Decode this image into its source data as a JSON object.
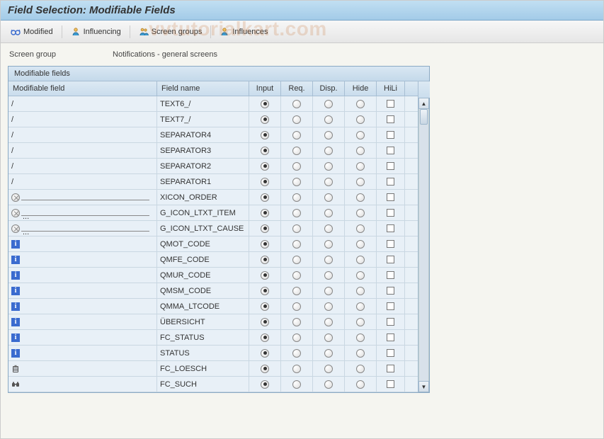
{
  "title": "Field Selection: Modifiable Fields",
  "toolbar": {
    "modified_label": "Modified",
    "influencing_label": "Influencing",
    "screen_groups_label": "Screen groups",
    "influences_label": "Influences"
  },
  "screen_group": {
    "label": "Screen group",
    "value": "Notifications - general screens"
  },
  "table": {
    "title": "Modifiable fields",
    "columns": {
      "modifiable_field": "Modifiable field",
      "field_name": "Field name",
      "input": "Input",
      "req": "Req.",
      "disp": "Disp.",
      "hide": "Hide",
      "hili": "HiLi"
    },
    "rows": [
      {
        "icon": "none",
        "modfield": "/",
        "line": false,
        "dots": false,
        "field_name": "TEXT6_/",
        "sel": "input"
      },
      {
        "icon": "none",
        "modfield": "/",
        "line": false,
        "dots": false,
        "field_name": "TEXT7_/",
        "sel": "input"
      },
      {
        "icon": "none",
        "modfield": "/",
        "line": false,
        "dots": false,
        "field_name": "SEPARATOR4",
        "sel": "input"
      },
      {
        "icon": "none",
        "modfield": "/",
        "line": false,
        "dots": false,
        "field_name": "SEPARATOR3",
        "sel": "input"
      },
      {
        "icon": "none",
        "modfield": "/",
        "line": false,
        "dots": false,
        "field_name": "SEPARATOR2",
        "sel": "input"
      },
      {
        "icon": "none",
        "modfield": "/",
        "line": false,
        "dots": false,
        "field_name": "SEPARATOR1",
        "sel": "input"
      },
      {
        "icon": "blank-o",
        "modfield": "",
        "line": true,
        "dots": false,
        "field_name": "XICON_ORDER",
        "sel": "input"
      },
      {
        "icon": "blank-o",
        "modfield": "",
        "line": true,
        "dots": true,
        "field_name": "G_ICON_LTXT_ITEM",
        "sel": "input"
      },
      {
        "icon": "blank-o",
        "modfield": "",
        "line": true,
        "dots": true,
        "field_name": "G_ICON_LTXT_CAUSE",
        "sel": "input"
      },
      {
        "icon": "info",
        "modfield": "",
        "line": false,
        "dots": false,
        "field_name": "QMOT_CODE",
        "sel": "input"
      },
      {
        "icon": "info",
        "modfield": "",
        "line": false,
        "dots": false,
        "field_name": "QMFE_CODE",
        "sel": "input"
      },
      {
        "icon": "info",
        "modfield": "",
        "line": false,
        "dots": false,
        "field_name": "QMUR_CODE",
        "sel": "input"
      },
      {
        "icon": "info",
        "modfield": "",
        "line": false,
        "dots": false,
        "field_name": "QMSM_CODE",
        "sel": "input"
      },
      {
        "icon": "info",
        "modfield": "",
        "line": false,
        "dots": false,
        "field_name": "QMMA_LTCODE",
        "sel": "input"
      },
      {
        "icon": "info",
        "modfield": "",
        "line": false,
        "dots": false,
        "field_name": "ÜBERSICHT",
        "sel": "input"
      },
      {
        "icon": "info",
        "modfield": "",
        "line": false,
        "dots": false,
        "field_name": "FC_STATUS",
        "sel": "input"
      },
      {
        "icon": "info",
        "modfield": "",
        "line": false,
        "dots": false,
        "field_name": "STATUS",
        "sel": "input"
      },
      {
        "icon": "trash",
        "modfield": "",
        "line": false,
        "dots": false,
        "field_name": "FC_LOESCH",
        "sel": "input"
      },
      {
        "icon": "search",
        "modfield": "",
        "line": false,
        "dots": false,
        "field_name": "FC_SUCH",
        "sel": "input"
      }
    ]
  },
  "watermark": "vvtutorialkart.com"
}
